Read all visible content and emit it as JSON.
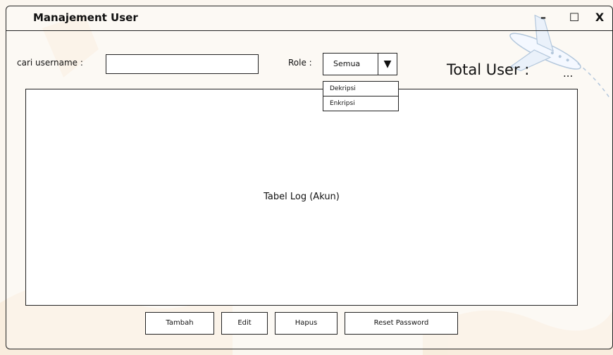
{
  "window": {
    "title": "Manajement User",
    "minimize_glyph": "–",
    "maximize_glyph": "☐",
    "close_glyph": "X"
  },
  "search": {
    "label": "cari username :",
    "value": "",
    "placeholder": ""
  },
  "role": {
    "label": "Role :",
    "selected": "Semua",
    "arrow_glyph": "▼",
    "options": [
      "Dekripsi",
      "Enkripsi"
    ]
  },
  "total": {
    "label": "Total User :",
    "value": "..."
  },
  "table": {
    "placeholder": "Tabel Log (Akun)"
  },
  "actions": {
    "add": "Tambah",
    "edit": "Edit",
    "delete": "Hapus",
    "reset_password": "Reset Password"
  },
  "decorations": {
    "background_icon": "airplane-icon"
  }
}
